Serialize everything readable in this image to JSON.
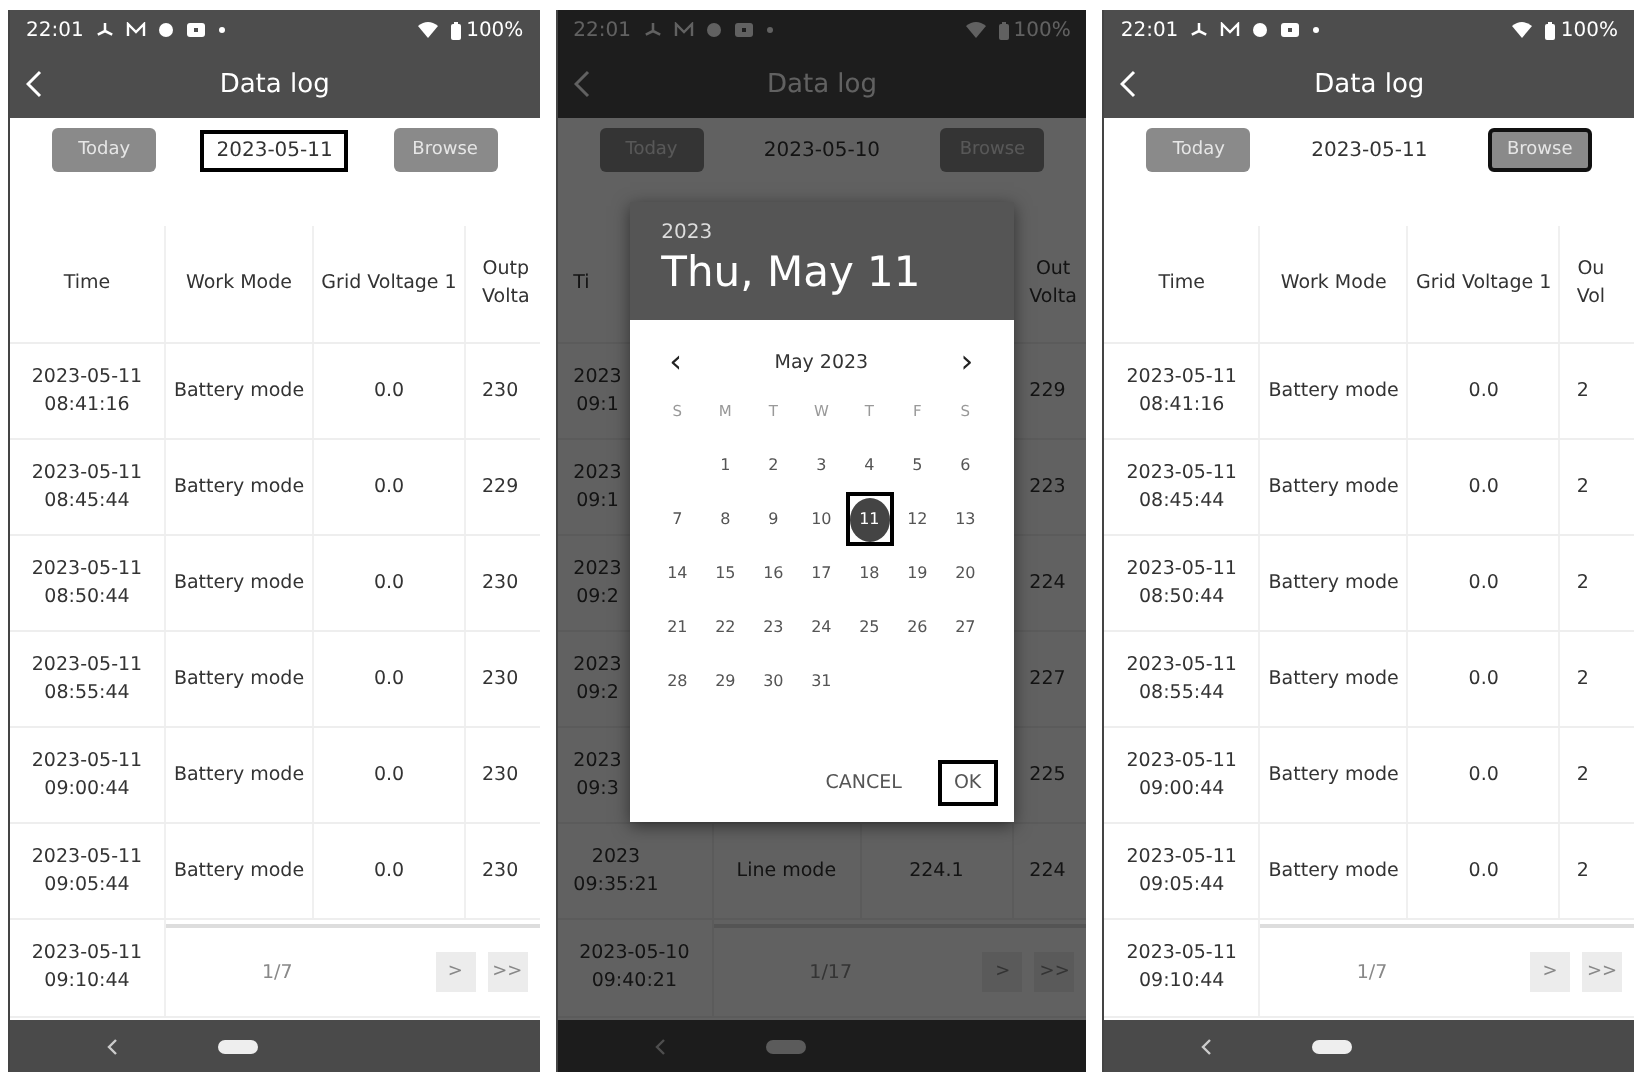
{
  "screens": [
    {
      "status": {
        "time": "22:01",
        "battery": "100%"
      },
      "title": "Data log",
      "toolbar": {
        "today": "Today",
        "date": "2023-05-11",
        "browse": "Browse",
        "date_highlighted": true,
        "browse_highlighted": false
      },
      "columns": [
        "Time",
        "Work Mode",
        "Grid Voltage 1",
        "Outp\nVolta"
      ],
      "rows": [
        {
          "time": "2023-05-11\n08:41:16",
          "mode": "Battery mode",
          "grid": "0.0",
          "out": "230"
        },
        {
          "time": "2023-05-11\n08:45:44",
          "mode": "Battery mode",
          "grid": "0.0",
          "out": "229"
        },
        {
          "time": "2023-05-11\n08:50:44",
          "mode": "Battery mode",
          "grid": "0.0",
          "out": "230"
        },
        {
          "time": "2023-05-11\n08:55:44",
          "mode": "Battery mode",
          "grid": "0.0",
          "out": "230"
        },
        {
          "time": "2023-05-11\n09:00:44",
          "mode": "Battery mode",
          "grid": "0.0",
          "out": "230"
        },
        {
          "time": "2023-05-11\n09:05:44",
          "mode": "Battery mode",
          "grid": "0.0",
          "out": "230"
        }
      ],
      "last_row": {
        "time": "2023-05-11\n09:10:44",
        "page": "1/7",
        "next": ">",
        "last": ">>"
      }
    },
    {
      "status": {
        "time": "22:01",
        "battery": "100%"
      },
      "title": "Data log",
      "toolbar": {
        "today": "Today",
        "date": "2023-05-10",
        "browse": "Browse",
        "date_highlighted": false,
        "browse_highlighted": false
      },
      "columns": [
        "Ti",
        "",
        "",
        "Out\nVolta"
      ],
      "rows": [
        {
          "time": "2023\n09:1",
          "out": "229"
        },
        {
          "time": "2023\n09:1",
          "out": "223"
        },
        {
          "time": "2023\n09:2",
          "out": "224"
        },
        {
          "time": "2023\n09:2",
          "out": "227"
        },
        {
          "time": "2023\n09:3",
          "out": "225"
        },
        {
          "time": "2023\n09:35:21",
          "mode": "Line mode",
          "grid": "224.1",
          "out": "224"
        }
      ],
      "last_row": {
        "time": "2023-05-10\n09:40:21",
        "page": "1/17",
        "next": ">",
        "last": ">>"
      },
      "dialog": {
        "year": "2023",
        "date": "Thu, May 11",
        "month": "May 2023",
        "prev": "‹",
        "next": "›",
        "weekdays": [
          "S",
          "M",
          "T",
          "W",
          "T",
          "F",
          "S"
        ],
        "weeks": [
          [
            {
              "day": "1",
              "selected": false
            },
            {
              "day": "2",
              "selected": false
            },
            {
              "day": "3",
              "selected": false
            },
            {
              "day": "4",
              "selected": false
            },
            {
              "day": "5",
              "selected": false
            },
            {
              "day": "6",
              "selected": false
            }
          ],
          [
            {
              "day": "7",
              "selected": false
            },
            {
              "day": "8",
              "selected": false
            },
            {
              "day": "9",
              "selected": false
            },
            {
              "day": "10",
              "selected": false
            },
            {
              "day": "11",
              "selected": true,
              "highlighted": true
            },
            {
              "day": "12",
              "selected": false
            },
            {
              "day": "13",
              "selected": false
            }
          ],
          [
            {
              "day": "14",
              "selected": false
            },
            {
              "day": "15",
              "selected": false
            },
            {
              "day": "16",
              "selected": false
            },
            {
              "day": "17",
              "selected": false
            },
            {
              "day": "18",
              "selected": false
            },
            {
              "day": "19",
              "selected": false
            },
            {
              "day": "20",
              "selected": false
            }
          ],
          [
            {
              "day": "21",
              "selected": false
            },
            {
              "day": "22",
              "selected": false
            },
            {
              "day": "23",
              "selected": false
            },
            {
              "day": "24",
              "selected": false
            },
            {
              "day": "25",
              "selected": false
            },
            {
              "day": "26",
              "selected": false
            },
            {
              "day": "27",
              "selected": false
            }
          ],
          [
            {
              "day": "28",
              "selected": false
            },
            {
              "day": "29",
              "selected": false
            },
            {
              "day": "30",
              "selected": false
            },
            {
              "day": "31",
              "selected": false
            }
          ]
        ],
        "cancel": "CANCEL",
        "ok": "OK",
        "ok_highlighted": true
      }
    },
    {
      "status": {
        "time": "22:01",
        "battery": "100%"
      },
      "title": "Data log",
      "toolbar": {
        "today": "Today",
        "date": "2023-05-11",
        "browse": "Browse",
        "date_highlighted": false,
        "browse_highlighted": true
      },
      "columns": [
        "Time",
        "Work Mode",
        "Grid Voltage 1",
        "Ou\nVol"
      ],
      "rows": [
        {
          "time": "2023-05-11\n08:41:16",
          "mode": "Battery mode",
          "grid": "0.0",
          "out": "2"
        },
        {
          "time": "2023-05-11\n08:45:44",
          "mode": "Battery mode",
          "grid": "0.0",
          "out": "2"
        },
        {
          "time": "2023-05-11\n08:50:44",
          "mode": "Battery mode",
          "grid": "0.0",
          "out": "2"
        },
        {
          "time": "2023-05-11\n08:55:44",
          "mode": "Battery mode",
          "grid": "0.0",
          "out": "2"
        },
        {
          "time": "2023-05-11\n09:00:44",
          "mode": "Battery mode",
          "grid": "0.0",
          "out": "2"
        },
        {
          "time": "2023-05-11\n09:05:44",
          "mode": "Battery mode",
          "grid": "0.0",
          "out": "2"
        }
      ],
      "last_row": {
        "time": "2023-05-11\n09:10:44",
        "page": "1/7",
        "next": ">",
        "last": ">>"
      }
    }
  ]
}
